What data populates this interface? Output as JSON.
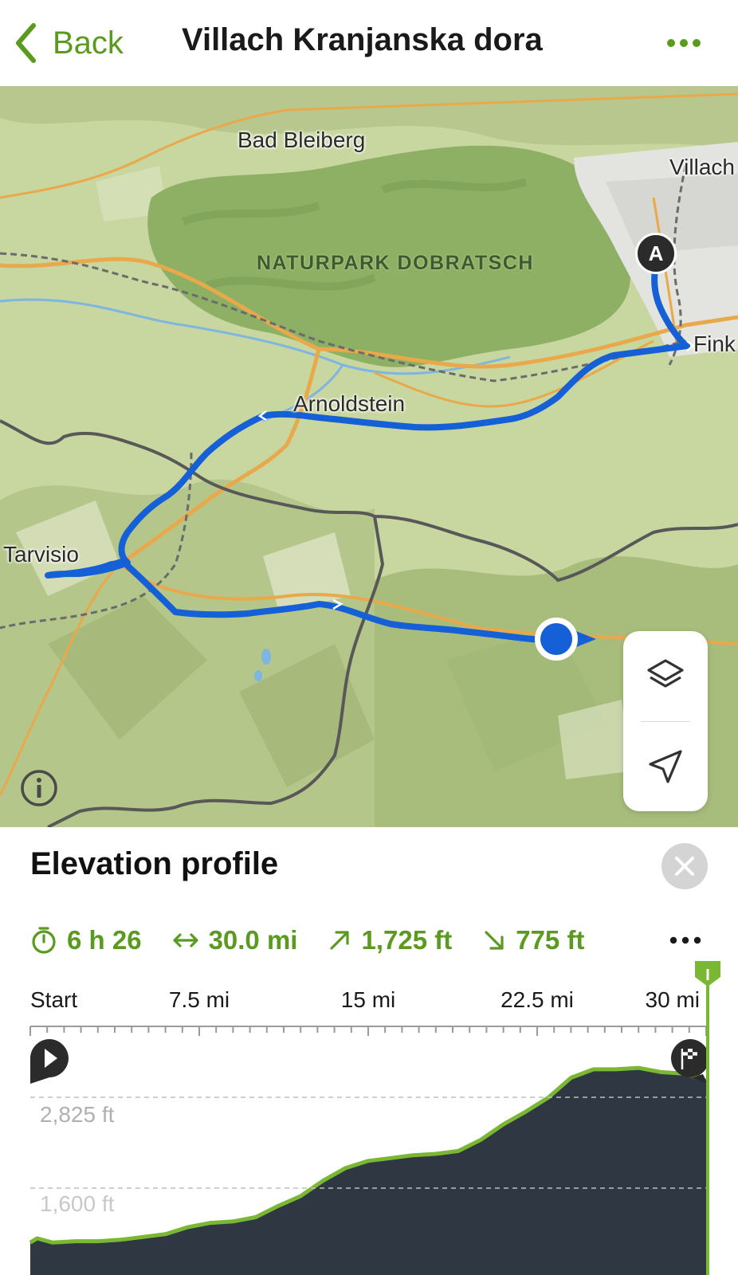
{
  "header": {
    "back_label": "Back",
    "title": "Villach Kranjanska dora"
  },
  "map": {
    "labels": {
      "bad_bleiberg": "Bad Bleiberg",
      "villach": "Villach",
      "park": "NATURPARK DOBRATSCH",
      "finkenstein": "Fink",
      "arnoldstein": "Arnoldstein",
      "tarvisio": "Tarvisio"
    },
    "start_marker": "A",
    "colors": {
      "route": "#1560d6",
      "land": "#c9d7a0",
      "forest": "#8fb068",
      "road": "#e9a94b",
      "border": "#585858"
    }
  },
  "elevation": {
    "title": "Elevation profile",
    "stats": {
      "duration": "6 h 26",
      "distance": "30.0 mi",
      "ascent": "1,725 ft",
      "descent": "775 ft"
    },
    "accent": "#5a9a1e"
  },
  "chart_data": {
    "type": "area",
    "title": "Elevation profile",
    "x_unit": "mi",
    "y_unit": "ft",
    "x_ticks": [
      "Start",
      "7.5 mi",
      "15 mi",
      "22.5 mi",
      "30 mi"
    ],
    "y_ticks": [
      "2,825 ft",
      "1,600 ft"
    ],
    "xlim": [
      0,
      30.0
    ],
    "ylim": [
      1450,
      3000
    ],
    "x": [
      0,
      0.3,
      1,
      2,
      3,
      4,
      5,
      6,
      7,
      8,
      9,
      10,
      11,
      12,
      13,
      14,
      15,
      16,
      17,
      18,
      19,
      20,
      21,
      22,
      23,
      24,
      25,
      26,
      27,
      28,
      29,
      30
    ],
    "y": [
      1680,
      1710,
      1680,
      1690,
      1690,
      1700,
      1720,
      1740,
      1790,
      1820,
      1830,
      1860,
      1940,
      2010,
      2120,
      2210,
      2260,
      2280,
      2300,
      2310,
      2330,
      2410,
      2520,
      2610,
      2710,
      2850,
      2910,
      2910,
      2920,
      2890,
      2880,
      2830
    ],
    "colors": {
      "fill": "#2e3742",
      "line": "#7ab733"
    }
  }
}
